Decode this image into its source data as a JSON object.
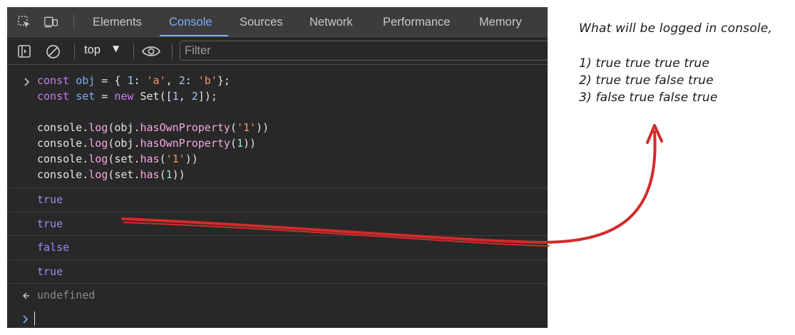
{
  "tabs": [
    "Elements",
    "Console",
    "Sources",
    "Network",
    "Performance",
    "Memory"
  ],
  "active_tab": "Console",
  "toolbar": {
    "context": "top",
    "filter_placeholder": "Filter"
  },
  "console": {
    "input_lines": [
      [
        [
          "kw",
          "const "
        ],
        [
          "var",
          "obj"
        ],
        [
          "plain",
          " = { "
        ],
        [
          "num",
          "1"
        ],
        [
          "plain",
          ": "
        ],
        [
          "str",
          "'a'"
        ],
        [
          "plain",
          ", "
        ],
        [
          "num",
          "2"
        ],
        [
          "plain",
          ": "
        ],
        [
          "str",
          "'b'"
        ],
        [
          "plain",
          "};"
        ]
      ],
      [
        [
          "kw",
          "const "
        ],
        [
          "var",
          "set"
        ],
        [
          "plain",
          " = "
        ],
        [
          "kw",
          "new "
        ],
        [
          "plain",
          "Set(["
        ],
        [
          "num",
          "1"
        ],
        [
          "plain",
          ", "
        ],
        [
          "num",
          "2"
        ],
        [
          "plain",
          "]);"
        ]
      ],
      [],
      [
        [
          "plain",
          "console."
        ],
        [
          "fn",
          "log"
        ],
        [
          "plain",
          "(obj."
        ],
        [
          "fn",
          "hasOwnProperty"
        ],
        [
          "plain",
          "("
        ],
        [
          "str",
          "'1'"
        ],
        [
          "plain",
          "))"
        ]
      ],
      [
        [
          "plain",
          "console."
        ],
        [
          "fn",
          "log"
        ],
        [
          "plain",
          "(obj."
        ],
        [
          "fn",
          "hasOwnProperty"
        ],
        [
          "plain",
          "("
        ],
        [
          "num2",
          "1"
        ],
        [
          "plain",
          "))"
        ]
      ],
      [
        [
          "plain",
          "console."
        ],
        [
          "fn",
          "log"
        ],
        [
          "plain",
          "(set."
        ],
        [
          "fn",
          "has"
        ],
        [
          "plain",
          "("
        ],
        [
          "str",
          "'1'"
        ],
        [
          "plain",
          "))"
        ]
      ],
      [
        [
          "plain",
          "console."
        ],
        [
          "fn",
          "log"
        ],
        [
          "plain",
          "(set."
        ],
        [
          "fn",
          "has"
        ],
        [
          "plain",
          "("
        ],
        [
          "num2",
          "1"
        ],
        [
          "plain",
          "))"
        ]
      ]
    ],
    "outputs": [
      "true",
      "true",
      "false",
      "true"
    ],
    "return_value": "undefined"
  },
  "annotation": {
    "question": "What will be logged in console,",
    "options": [
      "1) true true true true",
      "2) true true false true",
      "3) false true false true"
    ]
  },
  "colors": {
    "arrow": "#d42a2a",
    "devtools_bg": "#282828",
    "accent": "#7cacf8"
  },
  "icons": [
    "inspect-element-icon",
    "device-toolbar-icon",
    "sidebar-toggle-icon",
    "clear-console-icon",
    "eye-icon",
    "prompt-chevron-icon",
    "return-arrow-icon"
  ]
}
